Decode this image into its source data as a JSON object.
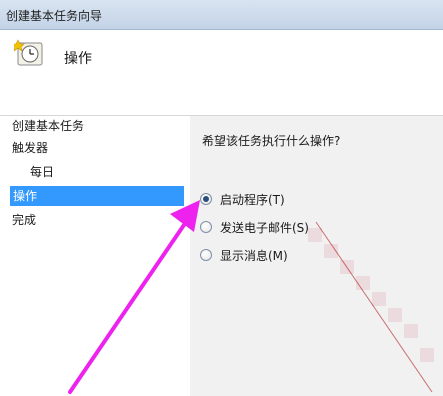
{
  "window": {
    "title": "创建基本任务向导"
  },
  "header": {
    "heading": "操作",
    "icon": "clock-icon"
  },
  "sidebar": {
    "items": [
      {
        "label": "创建基本任务"
      },
      {
        "label": "触发器"
      },
      {
        "label": "每日"
      },
      {
        "label": "操作"
      },
      {
        "label": "完成"
      }
    ]
  },
  "main": {
    "prompt": "希望该任务执行什么操作?",
    "options": [
      {
        "label": "启动程序(T)",
        "selected": true
      },
      {
        "label": "发送电子邮件(S)",
        "selected": false
      },
      {
        "label": "显示消息(M)",
        "selected": false
      }
    ]
  },
  "colors": {
    "selection": "#3399ff",
    "arrow": "#ee22ee",
    "titlebar": "#c9d8ea"
  }
}
